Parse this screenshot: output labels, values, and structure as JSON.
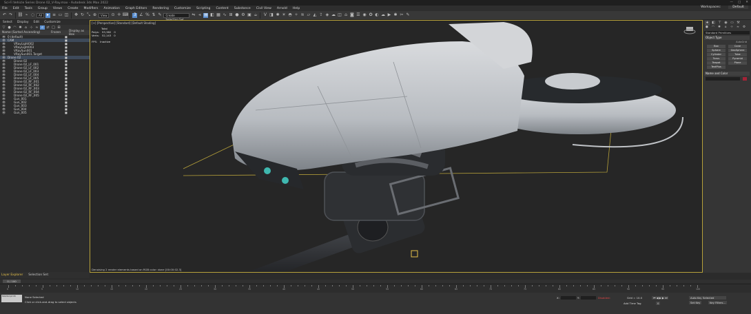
{
  "window": {
    "title": "Sci-Fi Vehicle Series Drone 02_V-Ray.max - Autodesk 3ds Max 2022",
    "controls": [
      "—",
      "□",
      "✕"
    ]
  },
  "menu": {
    "items": [
      "File",
      "Edit",
      "Tools",
      "Group",
      "Views",
      "Create",
      "Modifiers",
      "Animation",
      "Graph Editors",
      "Rendering",
      "Customize",
      "Scripting",
      "Content",
      "Substance",
      "Civil View",
      "Arnold",
      "Help"
    ],
    "workspaces_label": "Workspaces:",
    "workspace_value": "Default"
  },
  "toolbar": {
    "filter_value": "All",
    "view_value": "View",
    "selection_set_placeholder": "Create Selection Set"
  },
  "explorer": {
    "tabs": [
      "Select",
      "Display",
      "Edit",
      "Customize"
    ],
    "col_name": "Name (Sorted Ascending)",
    "col_frozen": "Frozen",
    "col_display": "Display as Box",
    "rows": [
      {
        "label": "0 (default)",
        "indent": 1,
        "hl": false
      },
      {
        "label": "CAM",
        "indent": 1,
        "hl": true
      },
      {
        "label": "VRayLight002",
        "indent": 2,
        "hl": false
      },
      {
        "label": "VRayLight003",
        "indent": 2,
        "hl": false
      },
      {
        "label": "VRaySun001",
        "indent": 2,
        "hl": false
      },
      {
        "label": "VRaySun001.Target",
        "indent": 2,
        "hl": false
      },
      {
        "label": "Drone 02",
        "indent": 1,
        "hl": true
      },
      {
        "label": "Drone 02",
        "indent": 2,
        "hl": false
      },
      {
        "label": "Drone 02_LF_001",
        "indent": 2,
        "hl": false
      },
      {
        "label": "Drone 02_LF_002",
        "indent": 2,
        "hl": false
      },
      {
        "label": "Drone 02_LF_003",
        "indent": 2,
        "hl": false
      },
      {
        "label": "Drone 02_LF_004",
        "indent": 2,
        "hl": false
      },
      {
        "label": "Drone 02_LF_005",
        "indent": 2,
        "hl": false
      },
      {
        "label": "Drone 02_RF_001",
        "indent": 2,
        "hl": false
      },
      {
        "label": "Drone 02_RF_002",
        "indent": 2,
        "hl": false
      },
      {
        "label": "Drone 02_RF_003",
        "indent": 2,
        "hl": false
      },
      {
        "label": "Drone 02_RF_004",
        "indent": 2,
        "hl": false
      },
      {
        "label": "Drone 02_RF_005",
        "indent": 2,
        "hl": false
      },
      {
        "label": "Gun_001",
        "indent": 2,
        "hl": false
      },
      {
        "label": "Gun_002",
        "indent": 2,
        "hl": false
      },
      {
        "label": "Gun_003",
        "indent": 2,
        "hl": false
      },
      {
        "label": "Gun_004",
        "indent": 2,
        "hl": false
      },
      {
        "label": "Gun_005",
        "indent": 2,
        "hl": false
      }
    ],
    "bottom_left": "Layer Explorer",
    "bottom_right": "Selection Set:"
  },
  "viewport": {
    "label": "[+] [Perspective] [Standard] [Default Shading]",
    "stats_title": "Total",
    "polys_label": "Polys:",
    "polys_value": "93,382",
    "polys_sel": "0",
    "verts_label": "Verts:",
    "verts_value": "52,143",
    "verts_sel": "0",
    "fps_label": "FPS:",
    "fps_value": "Inactive",
    "status": "Denoising 2 render elements based on RGB color: done [00:00:02.3]"
  },
  "command_panel": {
    "dropdown": "Standard Primitives",
    "object_type_title": "Object Type",
    "autogrid": "AutoGrid",
    "objects": [
      "Box",
      "Cone",
      "Sphere",
      "GeoSphere",
      "Cylinder",
      "Tube",
      "Torus",
      "Pyramid",
      "Teapot",
      "Plane",
      "TextPlus"
    ],
    "name_color_title": "Name and Color",
    "swatch_color": "#a42337"
  },
  "timeline": {
    "slider_label": "0 / 100",
    "ticks": [
      "0",
      "5",
      "10",
      "15",
      "20",
      "25",
      "30",
      "35",
      "40",
      "45",
      "50",
      "55",
      "60",
      "65",
      "70",
      "75",
      "80",
      "85",
      "90",
      "95",
      "100"
    ]
  },
  "status": {
    "maxscript": "MAXScript Mi",
    "line1": "None Selected",
    "line2": "Click or click-and-drag to select objects",
    "x_label": "X:",
    "y_label": "Y:",
    "z_label": "Z:",
    "disabled": "Disabled:",
    "grid": "Grid = 10.0",
    "add_time_tag": "Add Time Tag",
    "auto_key": "Auto Key",
    "selected": "Selected",
    "set_key": "Set Key",
    "key_filters": "Key Filters...",
    "frame_value": "0"
  }
}
